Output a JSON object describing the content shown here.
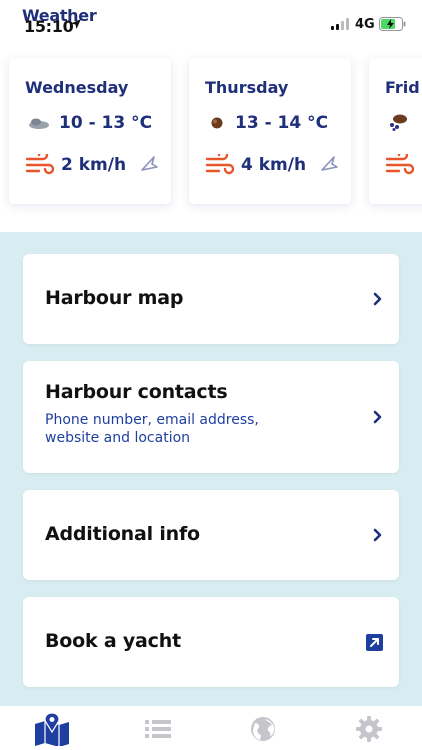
{
  "status_bar": {
    "overlay_title": "Weather",
    "time": "15:10",
    "network": "4G"
  },
  "forecast": [
    {
      "day": "Wednesday",
      "temp": "10 - 13 °C",
      "wind": "2 km/h",
      "icon": "cloud-icon"
    },
    {
      "day": "Thursday",
      "temp": "13 - 14 °C",
      "wind": "4 km/h",
      "icon": "sun-cloud-icon"
    },
    {
      "day": "Frid",
      "temp": "",
      "wind": "",
      "icon": "rain-icon"
    }
  ],
  "menu": {
    "harbour_map": {
      "title": "Harbour map"
    },
    "harbour_contacts": {
      "title": "Harbour contacts",
      "subtitle": "Phone number, email address, website and location"
    },
    "additional_info": {
      "title": "Additional info"
    },
    "book_yacht": {
      "title": "Book a yacht"
    }
  },
  "nav": [
    "map-icon",
    "list-icon",
    "globe-icon",
    "settings-icon"
  ],
  "colors": {
    "brand_navy": "#1f2f7a",
    "accent_orange": "#e8552b",
    "background_teal": "#d8edf1",
    "nav_inactive": "#c4c6cc"
  }
}
